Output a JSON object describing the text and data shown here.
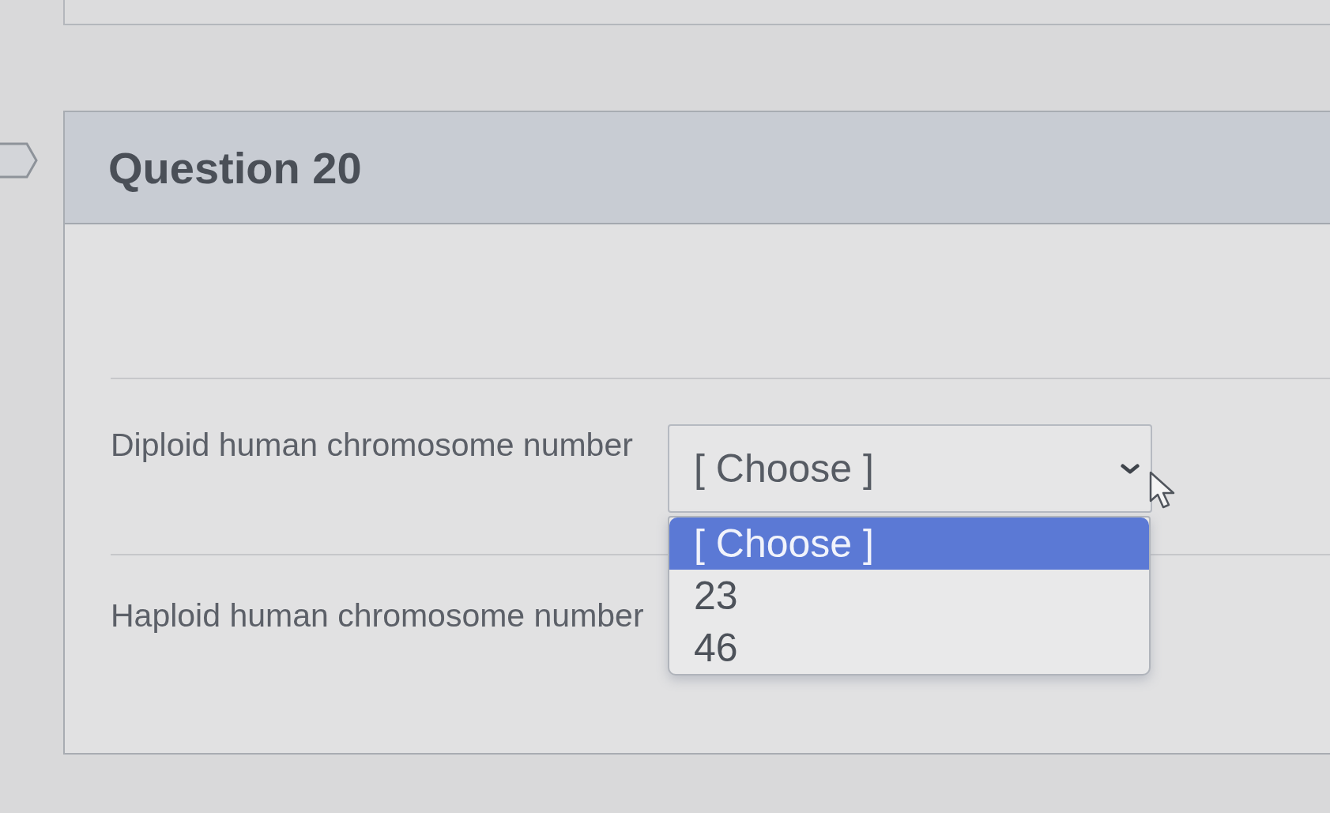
{
  "question": {
    "title": "Question 20"
  },
  "answers": [
    {
      "label": "Diploid human chromosome number",
      "select": {
        "value": "[ Choose ]",
        "open": true,
        "options": [
          {
            "label": "[ Choose ]",
            "selected": true
          },
          {
            "label": "23",
            "selected": false
          },
          {
            "label": "46",
            "selected": false
          }
        ]
      }
    },
    {
      "label": "Haploid human chromosome number"
    }
  ]
}
